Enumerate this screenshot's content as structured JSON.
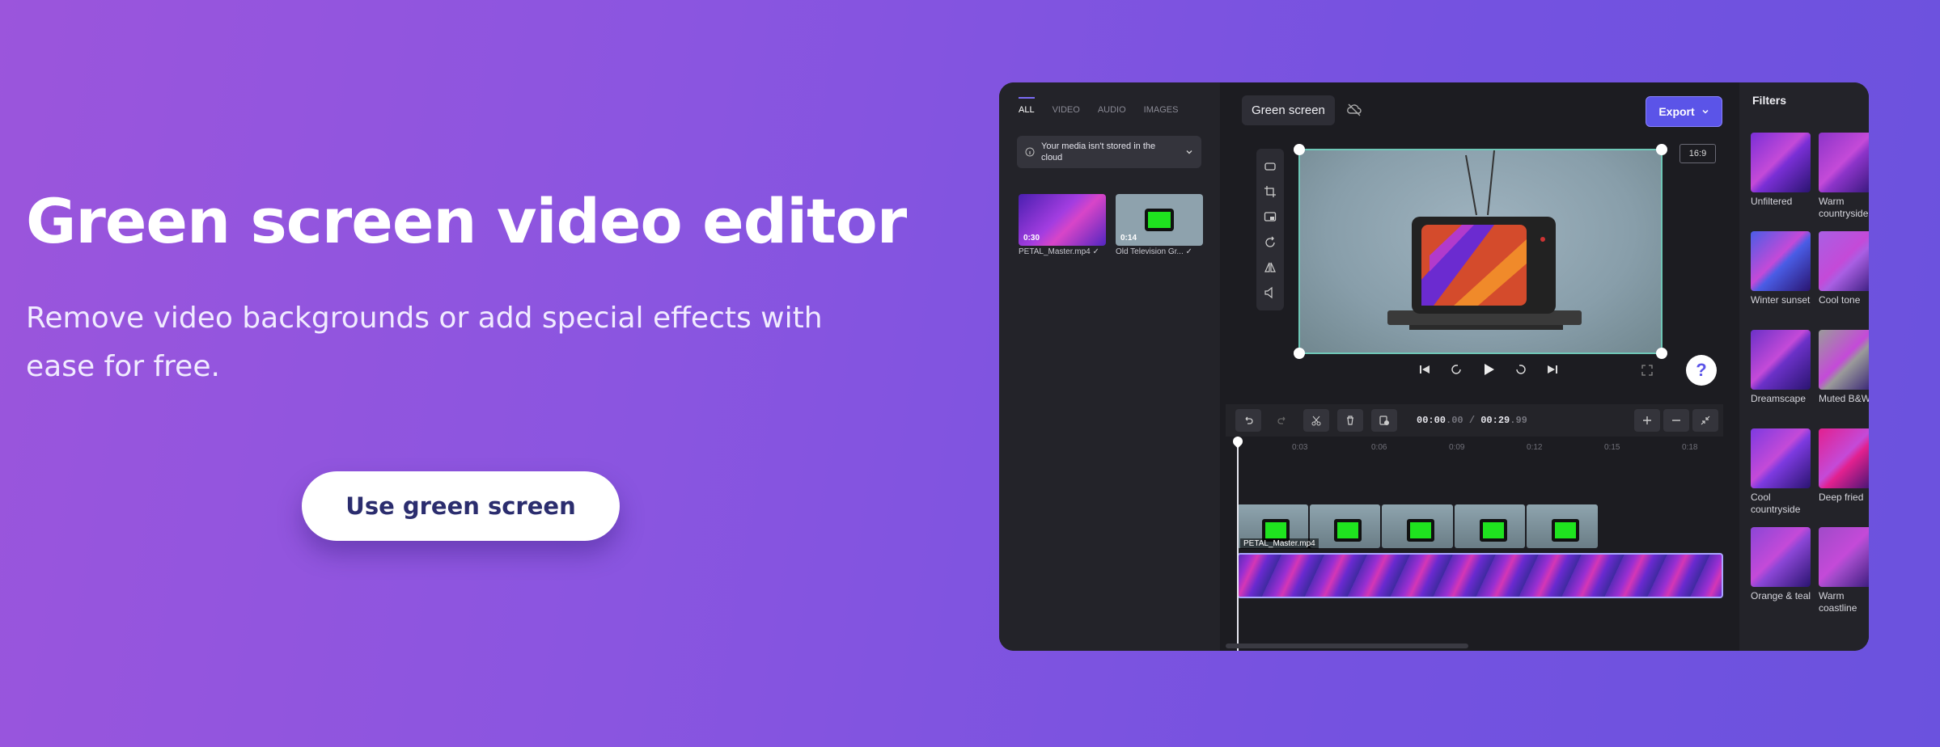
{
  "hero": {
    "title": "Green screen video editor",
    "subtitle": "Remove video backgrounds or add special effects with ease for free.",
    "cta_label": "Use green screen"
  },
  "editor": {
    "media_tabs": [
      "ALL",
      "VIDEO",
      "AUDIO",
      "IMAGES"
    ],
    "cloud_note": "Your media isn't stored in the cloud",
    "media_items": [
      {
        "duration": "0:30",
        "name": "PETAL_Master.mp4 ✓"
      },
      {
        "duration": "0:14",
        "name": "Old Television Gr... ✓"
      }
    ],
    "preview_tab": "Green screen",
    "export_label": "Export",
    "aspect_ratio": "16:9",
    "help_label": "?",
    "timecode_current": "00:00",
    "timecode_current_frac": ".00",
    "timecode_sep": " / ",
    "timecode_total": "00:29",
    "timecode_total_frac": ".99",
    "ruler_ticks": [
      "0:03",
      "0:06",
      "0:09",
      "0:12",
      "0:15",
      "0:18"
    ],
    "clip_label": "PETAL_Master.mp4",
    "filters_title": "Filters",
    "filters": [
      {
        "name": "Unfiltered",
        "color": "#7a2fd6"
      },
      {
        "name": "Warm countryside",
        "color": "#8c34c9"
      },
      {
        "name": "Winter sunset",
        "color": "#4a5de6"
      },
      {
        "name": "Cool tone",
        "color": "#a95fe3"
      },
      {
        "name": "Dreamscape",
        "color": "#6b31c8"
      },
      {
        "name": "Muted B&W",
        "color": "#9a9a9a"
      },
      {
        "name": "Cool countryside",
        "color": "#7d3ae0"
      },
      {
        "name": "Deep fried",
        "color": "#e2208f"
      },
      {
        "name": "Orange & teal",
        "color": "#8b46d6"
      },
      {
        "name": "Warm coastline",
        "color": "#a04ac9"
      }
    ]
  }
}
